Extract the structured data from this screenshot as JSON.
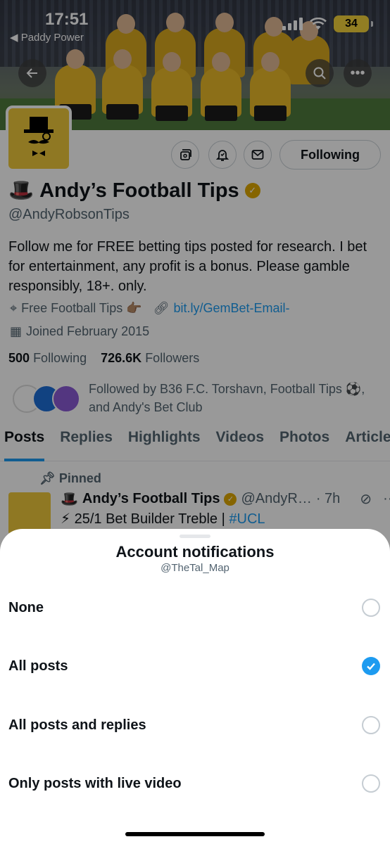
{
  "status_bar": {
    "time": "17:51",
    "back_app": "Paddy Power",
    "battery": "34"
  },
  "profile": {
    "following_label": "Following",
    "name": "Andy’s Football Tips",
    "name_emoji": "🎩",
    "handle": "@AndyRobsonTips",
    "bio": "Follow me for FREE betting tips posted for research. I bet for entertainment, any profit is a bonus. Please gamble responsibly, 18+. only.",
    "location": "Free Football Tips 👉🏽",
    "link": "bit.ly/GemBet-Email-",
    "joined": "Joined February 2015",
    "following_count": "500",
    "following_text": "Following",
    "followers_count": "726.6K",
    "followers_text": "Followers",
    "followed_by": "Followed by B36 F.C. Torshavn, Football Tips ⚽, and Andy's Bet Club"
  },
  "tabs": [
    "Posts",
    "Replies",
    "Highlights",
    "Videos",
    "Photos",
    "Articles"
  ],
  "pinned_post": {
    "pinned_label": "Pinned",
    "author": "Andy’s Football Tips",
    "handle": "@AndyR…",
    "time": "· 7h",
    "text": "⚡ 25/1 Bet Builder Treble | ",
    "hashtag": "#UCL"
  },
  "sheet": {
    "title": "Account notifications",
    "subtitle": "@TheTal_Map",
    "options": [
      {
        "label": "None",
        "checked": false
      },
      {
        "label": "All posts",
        "checked": true
      },
      {
        "label": "All posts and replies",
        "checked": false
      },
      {
        "label": "Only posts with live video",
        "checked": false
      }
    ]
  },
  "colors": {
    "accent": "#1d9bf0",
    "brand_yellow": "#eec83b"
  }
}
